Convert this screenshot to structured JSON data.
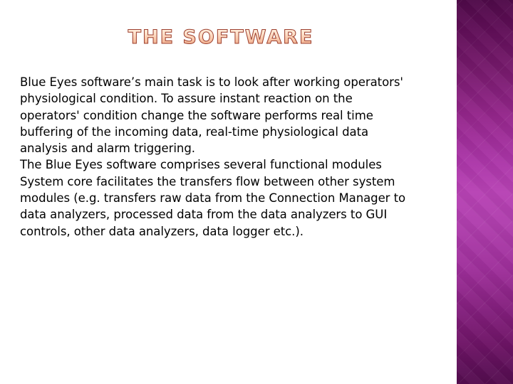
{
  "slide": {
    "title": "THE SOFTWARE",
    "background_color": "#ffffff",
    "title_fill_color": "#ffe3cd",
    "title_outline_color": "#9c3f2e"
  },
  "side_band": {
    "name": "decorative-gradient-band",
    "gradient_top_color": "#4f0a49",
    "gradient_mid_color": "#b742b4",
    "gradient_bottom_color": "#540c4e",
    "pattern": "diamond-argyle-lattice"
  },
  "body": {
    "lines": [
      "Blue Eyes software’s main task is to look after working operators'",
      "physiological condition. To assure instant reaction on the",
      "operators' condition change the software performs real time",
      "buffering of the incoming data, real-time physiological data",
      "analysis and alarm triggering.",
      "The Blue Eyes software comprises several functional modules",
      "System core facilitates the transfers flow between other system",
      "modules (e.g. transfers raw data from the Connection Manager to",
      "data analyzers, processed data from the data analyzers to GUI",
      "controls, other data analyzers, data logger etc.)."
    ]
  }
}
